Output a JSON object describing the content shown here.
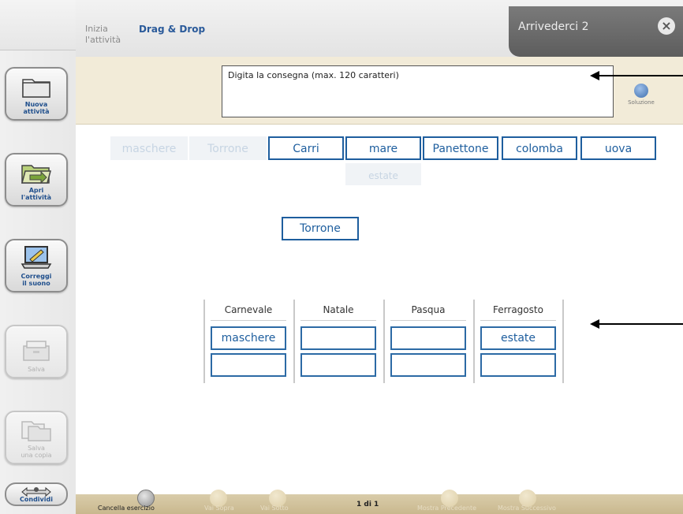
{
  "header": {
    "start_label": "Inizia\nl'attività",
    "start_line1": "Inizia",
    "start_line2": "l'attività",
    "mode_label": "Drag & Drop",
    "activity_title": "Arrivederci 2",
    "close_glyph": "×"
  },
  "sidebar": {
    "items": [
      {
        "label_1": "Nuova",
        "label_2": "attività",
        "icon": "folder-icon",
        "enabled": true
      },
      {
        "label_1": "Apri",
        "label_2": "l'attività",
        "icon": "open-folder-icon",
        "enabled": true
      },
      {
        "label_1": "Correggi",
        "label_2": "il suono",
        "icon": "laptop-pencil-icon",
        "enabled": true
      },
      {
        "label_1": "Salva",
        "label_2": "",
        "icon": "save-drawer-icon",
        "enabled": false
      },
      {
        "label_1": "Salva",
        "label_2": "una copia",
        "icon": "save-copy-icon",
        "enabled": false
      }
    ],
    "share_label": "Condividi",
    "share_icon": "share-people-icon"
  },
  "instructions": {
    "placeholder": "Digita  la consegna (max. 120 caratteri)",
    "solution_label": "Soluzione",
    "solution_icon": "wrench-icon"
  },
  "word_bank": {
    "words": [
      {
        "text": "maschere",
        "used": true
      },
      {
        "text": "Torrone",
        "used": true
      },
      {
        "text": "Carri",
        "used": false
      },
      {
        "text": "mare",
        "used": false
      },
      {
        "text": "Panettone",
        "used": false
      },
      {
        "text": "colomba",
        "used": false
      },
      {
        "text": "uova",
        "used": false
      },
      {
        "text": "estate",
        "used": true
      }
    ]
  },
  "dragged_word": "Torrone",
  "categories": [
    {
      "name": "Carnevale",
      "slots": [
        "maschere",
        ""
      ]
    },
    {
      "name": "Natale",
      "slots": [
        "",
        ""
      ]
    },
    {
      "name": "Pasqua",
      "slots": [
        "",
        ""
      ]
    },
    {
      "name": "Ferragosto",
      "slots": [
        "estate",
        ""
      ]
    }
  ],
  "bottom_bar": {
    "clear_label": "Cancella esercizio",
    "move_up_label": "Vai Sopra",
    "move_down_label": "Vai Sotto",
    "page_indicator": "1 di 1",
    "prev_label": "Mostra Precedente",
    "next_label": "Mostra Successivo"
  },
  "colors": {
    "accent": "#1e5e9e",
    "band": "#f2ebd8",
    "bottom_bar": "#cdbd93",
    "title_bar": "#6b6b6b"
  }
}
